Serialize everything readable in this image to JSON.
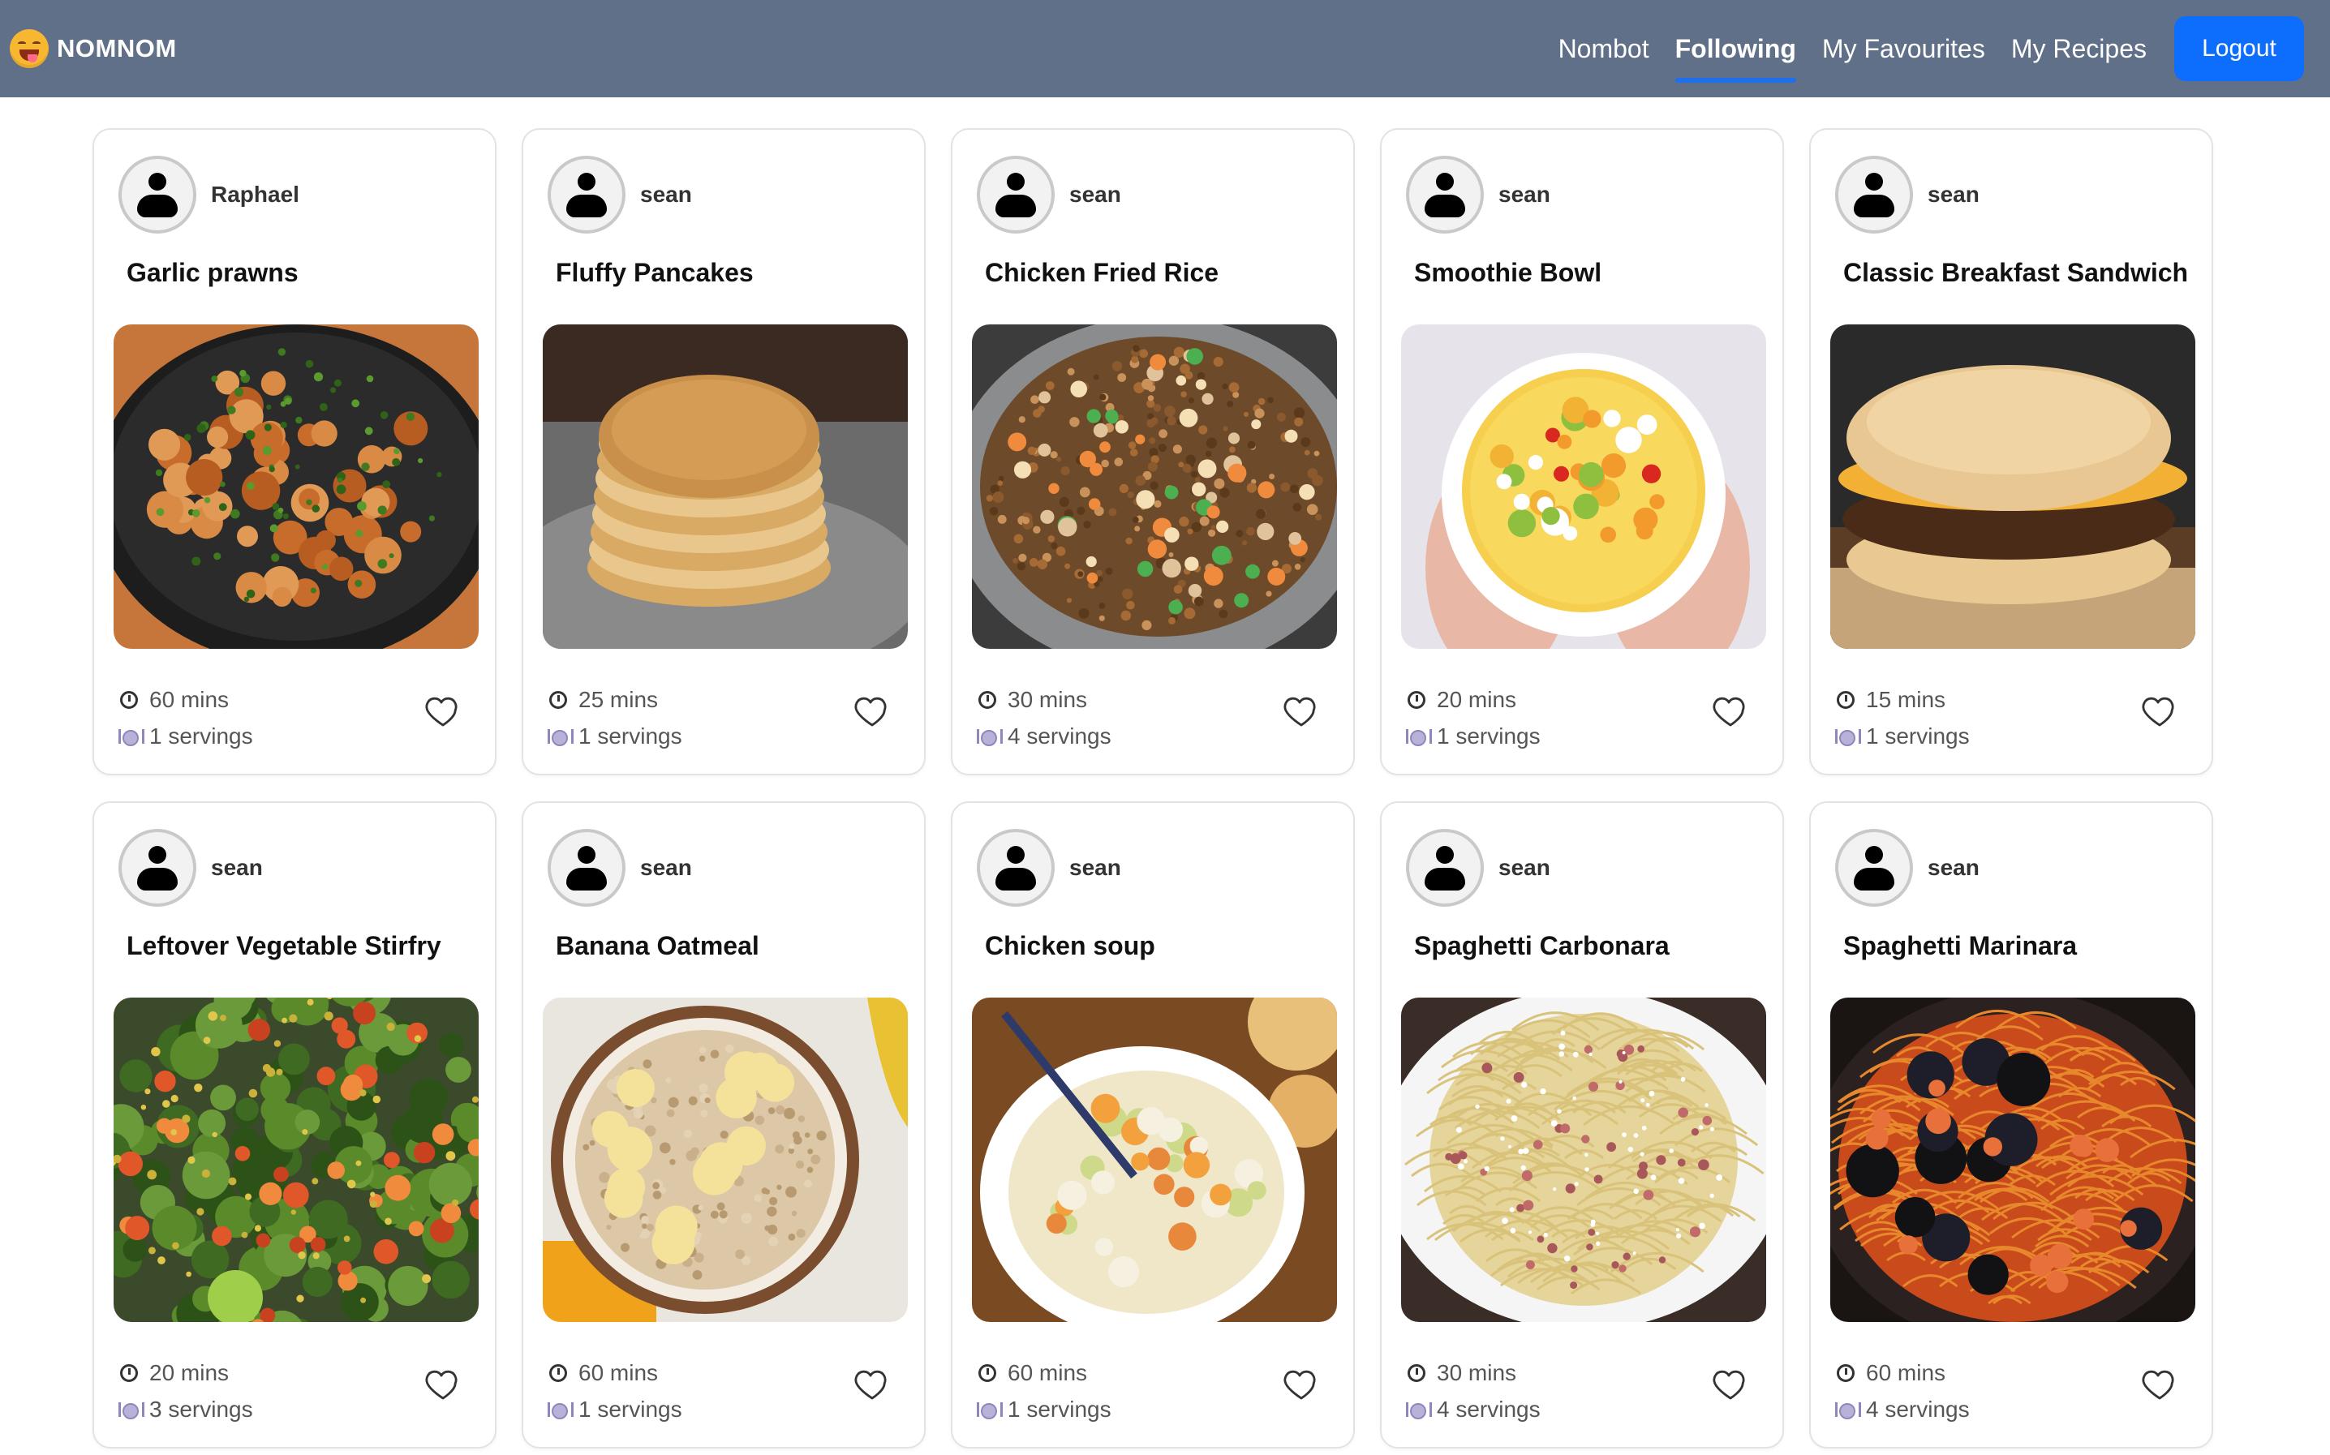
{
  "brand": {
    "name": "NOMNOM"
  },
  "nav": {
    "links": [
      {
        "label": "Nombot",
        "active": false
      },
      {
        "label": "Following",
        "active": true
      },
      {
        "label": "My Favourites",
        "active": false
      },
      {
        "label": "My Recipes",
        "active": false
      }
    ],
    "logout_label": "Logout"
  },
  "colors": {
    "navbar": "#607089",
    "accent": "#0d6efd"
  },
  "recipes": [
    {
      "user": "Raphael",
      "title": "Garlic prawns",
      "time": "60 mins",
      "servings": "1 servings",
      "image": "garlic-prawns"
    },
    {
      "user": "sean",
      "title": "Fluffy Pancakes",
      "time": "25 mins",
      "servings": "1 servings",
      "image": "pancakes"
    },
    {
      "user": "sean",
      "title": "Chicken Fried Rice",
      "time": "30 mins",
      "servings": "4 servings",
      "image": "fried-rice"
    },
    {
      "user": "sean",
      "title": "Smoothie Bowl",
      "time": "20 mins",
      "servings": "1 servings",
      "image": "smoothie-bowl"
    },
    {
      "user": "sean",
      "title": "Classic Breakfast Sandwich",
      "time": "15 mins",
      "servings": "1 servings",
      "image": "breakfast-sandwich"
    },
    {
      "user": "sean",
      "title": "Leftover Vegetable Stirfry",
      "time": "20 mins",
      "servings": "3 servings",
      "image": "stirfry"
    },
    {
      "user": "sean",
      "title": "Banana Oatmeal",
      "time": "60 mins",
      "servings": "1 servings",
      "image": "oatmeal"
    },
    {
      "user": "sean",
      "title": "Chicken soup",
      "time": "60 mins",
      "servings": "1 servings",
      "image": "chicken-soup"
    },
    {
      "user": "sean",
      "title": "Spaghetti Carbonara",
      "time": "30 mins",
      "servings": "4 servings",
      "image": "carbonara"
    },
    {
      "user": "sean",
      "title": "Spaghetti Marinara",
      "time": "60 mins",
      "servings": "4 servings",
      "image": "marinara"
    }
  ]
}
